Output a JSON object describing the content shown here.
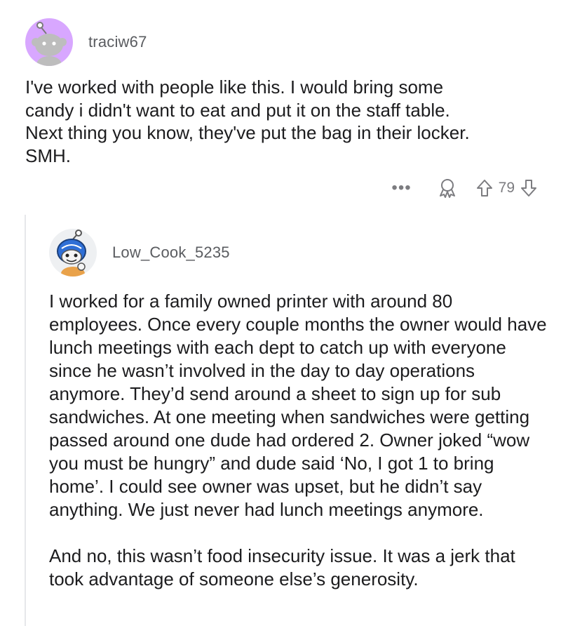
{
  "comment1": {
    "username": "traciw67",
    "body": "I've worked with people like this. I would bring some\ncandy i didn't want to eat and put it on the staff table.\nNext thing you know, they've put the bag in their locker.\nSMH.",
    "actions": {
      "more": "•••",
      "score": "79",
      "award_icon": "award-icon",
      "upvote_icon": "upvote-arrow-icon",
      "downvote_icon": "downvote-arrow-icon"
    }
  },
  "comment2": {
    "username": "Low_Cook_5235",
    "paragraph1": "I worked for a family owned printer with around 80 employees. Once every couple months the owner would have lunch meetings with each dept to catch up with everyone since he wasn’t involved in the day to day operations anymore. They’d send around a sheet to sign up for sub sandwiches. At one meeting when sandwiches were getting passed around one dude had ordered 2.  Owner joked “wow you must be hungry” and dude said ‘No, I got 1 to bring home’. I could see owner was upset, but he didn’t say anything. We just never had lunch meetings anymore.",
    "paragraph2": "And no, this wasn’t food insecurity issue. It was a jerk that took advantage of someone else’s generosity."
  },
  "colors": {
    "avatar1_bg": "#d8a7ff",
    "avatar2_bg": "#eef0f2",
    "username": "#5a5c60",
    "text": "#1c1c1e",
    "meta": "#7c7c80",
    "thread_line": "#e6e7ea"
  }
}
